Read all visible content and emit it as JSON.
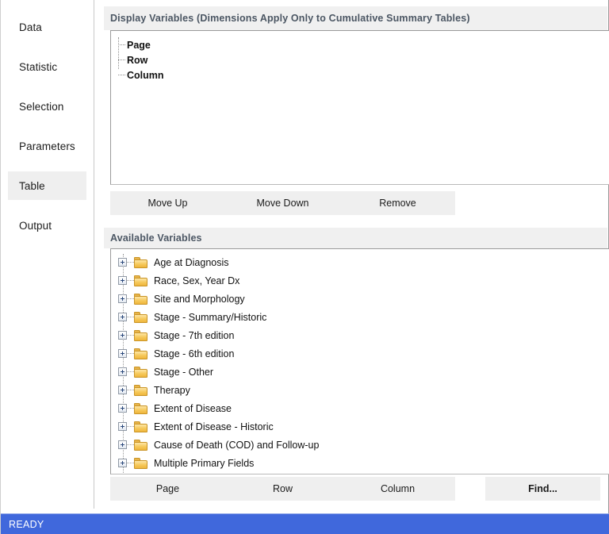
{
  "sidebar": {
    "items": [
      {
        "label": "Data",
        "selected": false
      },
      {
        "label": "Statistic",
        "selected": false
      },
      {
        "label": "Selection",
        "selected": false
      },
      {
        "label": "Parameters",
        "selected": false
      },
      {
        "label": "Table",
        "selected": true
      },
      {
        "label": "Output",
        "selected": false
      }
    ]
  },
  "display_variables": {
    "header": "Display Variables (Dimensions Apply Only to Cumulative Summary Tables)",
    "items": [
      {
        "label": "Page"
      },
      {
        "label": "Row"
      },
      {
        "label": "Column"
      }
    ],
    "buttons": {
      "move_up": "Move Up",
      "move_down": "Move Down",
      "remove": "Remove"
    }
  },
  "available_variables": {
    "header": "Available Variables",
    "items": [
      {
        "label": "Age at Diagnosis",
        "icon": "folder-icon",
        "expander": "plus-icon"
      },
      {
        "label": "Race, Sex, Year Dx",
        "icon": "folder-icon",
        "expander": "plus-icon"
      },
      {
        "label": "Site and Morphology",
        "icon": "folder-icon",
        "expander": "plus-icon"
      },
      {
        "label": "Stage - Summary/Historic",
        "icon": "folder-icon",
        "expander": "plus-icon"
      },
      {
        "label": "Stage - 7th edition",
        "icon": "folder-icon",
        "expander": "plus-icon"
      },
      {
        "label": "Stage - 6th edition",
        "icon": "folder-icon",
        "expander": "plus-icon"
      },
      {
        "label": "Stage - Other",
        "icon": "folder-icon",
        "expander": "plus-icon"
      },
      {
        "label": "Therapy",
        "icon": "folder-icon",
        "expander": "plus-icon"
      },
      {
        "label": "Extent of Disease",
        "icon": "folder-icon",
        "expander": "plus-icon"
      },
      {
        "label": "Extent of Disease - Historic",
        "icon": "folder-icon",
        "expander": "plus-icon"
      },
      {
        "label": "Cause of Death (COD) and Follow-up",
        "icon": "folder-icon",
        "expander": "plus-icon"
      },
      {
        "label": "Multiple Primary Fields",
        "icon": "folder-icon",
        "expander": "plus-icon"
      }
    ],
    "scrollbar": {
      "up_arrow": "∧",
      "down_arrow": "∨"
    },
    "buttons": {
      "page": "Page",
      "row": "Row",
      "column": "Column",
      "find": "Find..."
    }
  },
  "statusbar": {
    "text": "READY"
  },
  "colors": {
    "status_blue": "#4068dc",
    "header_bg": "#f0f0f0",
    "header_text": "#4b5663",
    "button_bg": "#efefef",
    "selected_nav_bg": "#efefef",
    "folder_yellow": "#f6c85a"
  }
}
